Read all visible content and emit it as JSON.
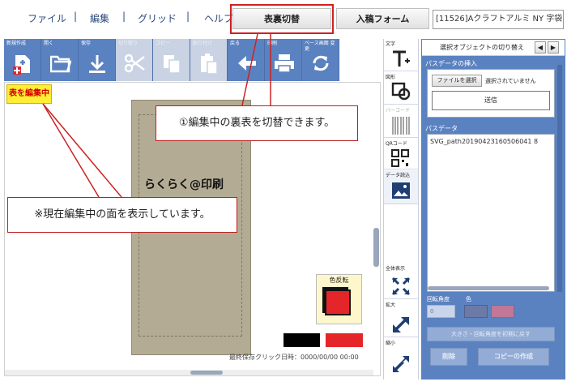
{
  "menu": {
    "file": "ファイル",
    "edit": "編集",
    "grid": "グリッド",
    "help": "ヘルプ",
    "sep": "|"
  },
  "top_buttons": {
    "flip": "表裏切替",
    "form": "入稿フォーム"
  },
  "product_title": "[11526]Aクラフトアルミ NY 字袋",
  "toolbar": [
    {
      "label": "新規作成",
      "icon": "new-file-icon",
      "enabled": true
    },
    {
      "label": "開く",
      "icon": "open-folder-icon",
      "enabled": true
    },
    {
      "label": "保存",
      "icon": "download-icon",
      "enabled": true
    },
    {
      "label": "切り取り",
      "icon": "scissors-icon",
      "enabled": false
    },
    {
      "label": "コピー",
      "icon": "copy-icon",
      "enabled": false
    },
    {
      "label": "貼り付け",
      "icon": "paste-icon",
      "enabled": false
    },
    {
      "label": "戻る",
      "icon": "arrow-left-icon",
      "enabled": true
    },
    {
      "label": "印刷",
      "icon": "printer-icon",
      "enabled": true
    },
    {
      "label": "ベース画面 変更",
      "icon": "refresh-icon",
      "enabled": true
    }
  ],
  "canvas": {
    "edit_label": "表を編集中",
    "logo_text": "らくらく@印刷",
    "callout1": "①編集中の裏表を切替できます。",
    "callout2": "※現在編集中の面を表示しています。",
    "color_invert": "色反転",
    "saved_text": "最終保存クリック日時：0000/00/00 00:00"
  },
  "side_tools": {
    "text": "文字",
    "shape": "図形",
    "barcode": "バーコード",
    "qrcode": "QRコード",
    "data_load": "データ読込",
    "fit_all": "全体表示",
    "zoom_in": "拡大",
    "zoom_out": "縮小"
  },
  "right_panel": {
    "title": "選択オブジェクトの切り替え",
    "prev": "◀",
    "next": "▶",
    "path_insert_label": "パスデータの挿入",
    "file_button": "ファイルを選択",
    "file_status": "選択されていません",
    "send_button": "送信",
    "path_data_label": "パスデータ",
    "path_data_value": "SVG_path20190423160506041 8",
    "rotation_label": "回転角度",
    "color_label": "色",
    "rotation_value": "0",
    "reset_button": "大きさ・回転角度を初期に戻す",
    "delete_button": "削除",
    "copy_button": "コピーの作成"
  },
  "colors": {
    "accent": "#5b82c0",
    "callout_border": "#b22222",
    "edit_label_bg": "#ffee33",
    "swatch_red": "#e4262a",
    "card": "#b3ab94"
  }
}
